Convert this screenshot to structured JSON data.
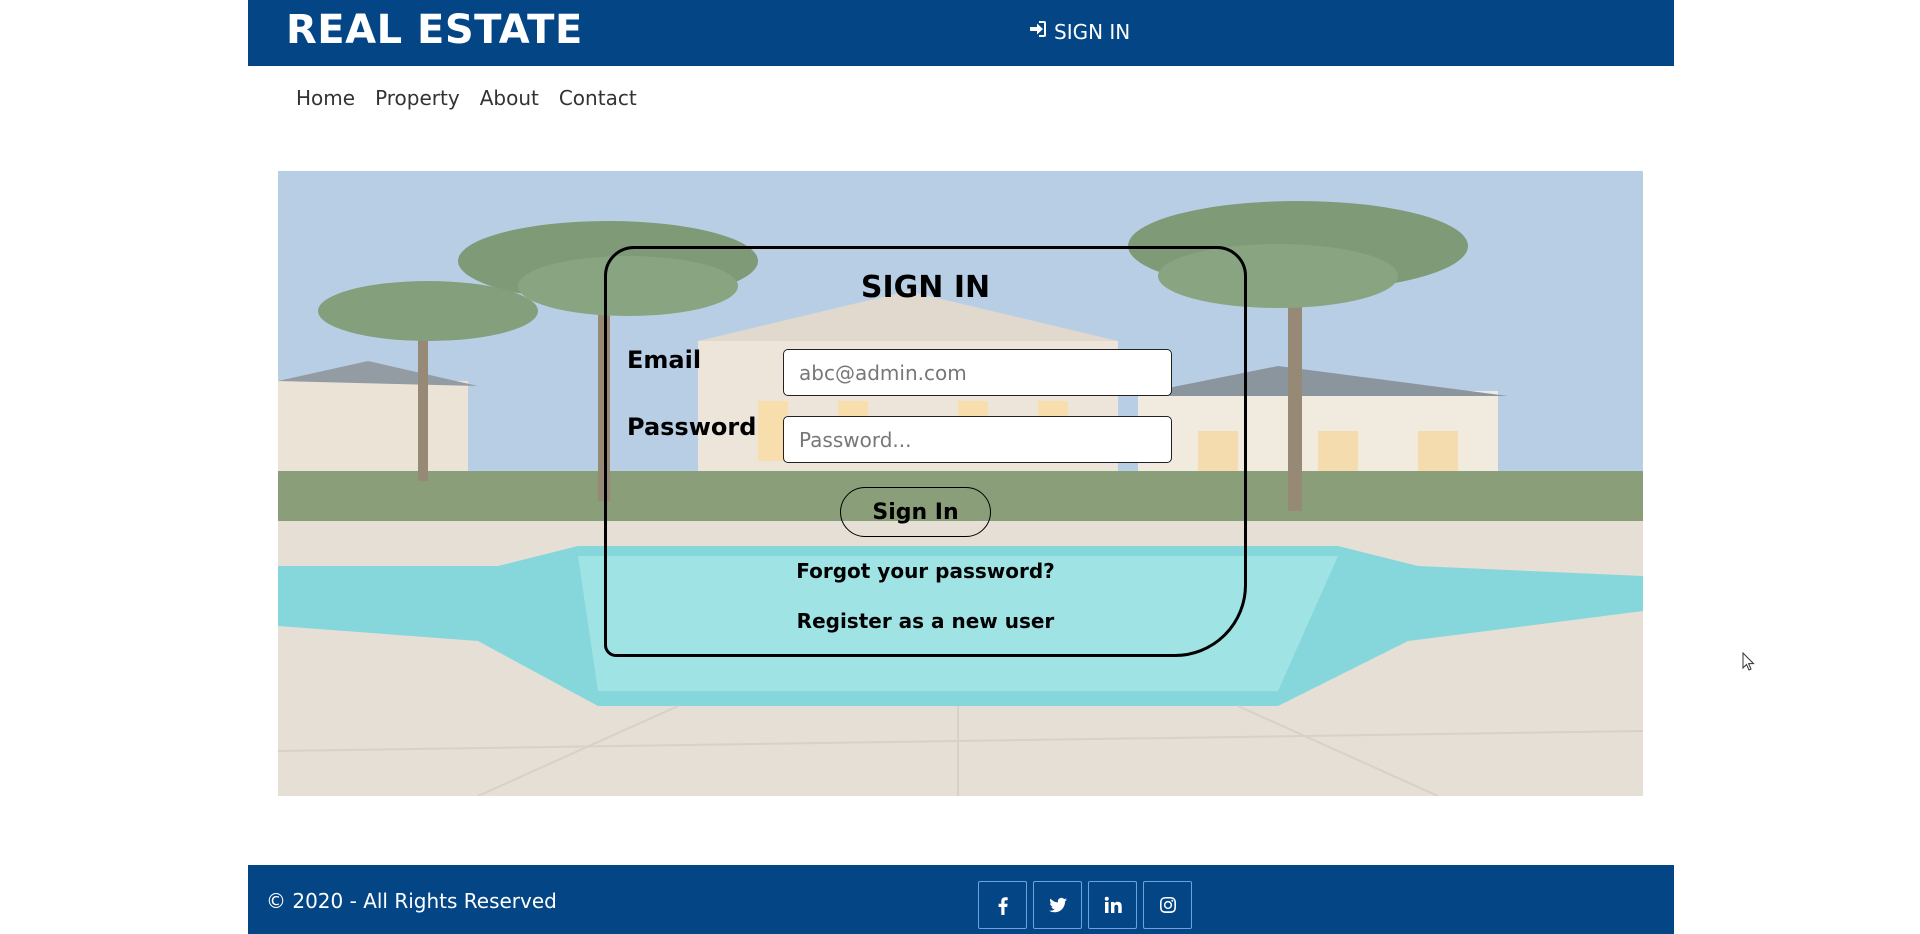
{
  "header": {
    "brand": "REAL ESTATE",
    "signin_label": "SIGN IN",
    "signin_icon": "sign-in-icon"
  },
  "nav": {
    "items": [
      {
        "label": "Home"
      },
      {
        "label": "Property"
      },
      {
        "label": "About"
      },
      {
        "label": "Contact"
      }
    ]
  },
  "signin_form": {
    "title": "SIGN IN",
    "email_label": "Email",
    "email_placeholder": "abc@admin.com",
    "password_label": "Password",
    "password_placeholder": "Password...",
    "submit_label": "Sign In",
    "forgot_label": "Forgot your password?",
    "register_label": "Register as a new user"
  },
  "footer": {
    "copyright": "© 2020 - All Rights Reserved",
    "socials": [
      "facebook-icon",
      "twitter-icon",
      "linkedin-icon",
      "instagram-icon"
    ]
  },
  "colors": {
    "brand_blue": "#044685",
    "social_border": "#6aa3de"
  }
}
